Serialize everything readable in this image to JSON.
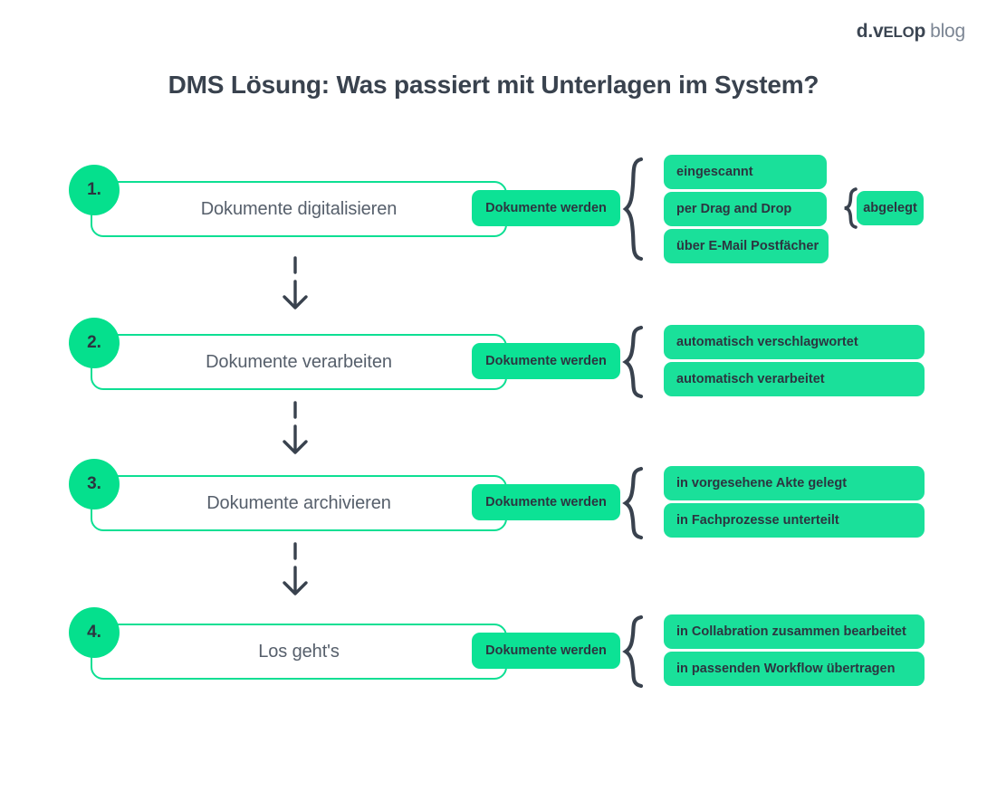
{
  "brand": {
    "mark_a": "d.v",
    "mark_sc": "elo",
    "mark_b": "p",
    "word": "blog"
  },
  "title": "DMS Lösung: Was passiert mit Unterlagen im System?",
  "colors": {
    "circle_green": "#05e08d",
    "pill_green": "#1ae09a",
    "box_border_green": "#0ddf93",
    "text_dark": "#39424e",
    "brace_dark": "#39424e",
    "background": "#ffffff"
  },
  "steps": [
    {
      "number": "1.",
      "label": "Dokumente digitalisieren",
      "connector_label": "Dokumente werden",
      "options": [
        "eingescannt",
        "per Drag and Drop",
        "über E-Mail Postfächer"
      ],
      "result": "abgelegt"
    },
    {
      "number": "2.",
      "label": "Dokumente verarbeiten",
      "connector_label": "Dokumente werden",
      "options": [
        "automatisch verschlagwortet",
        "automatisch verarbeitet"
      ],
      "result": null
    },
    {
      "number": "3.",
      "label": "Dokumente archivieren",
      "connector_label": "Dokumente werden",
      "options": [
        "in vorgesehene Akte gelegt",
        "in Fachprozesse unterteilt"
      ],
      "result": null
    },
    {
      "number": "4.",
      "label": "Los geht's",
      "connector_label": "Dokumente werden",
      "options": [
        "in Collabration zusammen bearbeitet",
        "in passenden Workflow übertragen"
      ],
      "result": null
    }
  ]
}
